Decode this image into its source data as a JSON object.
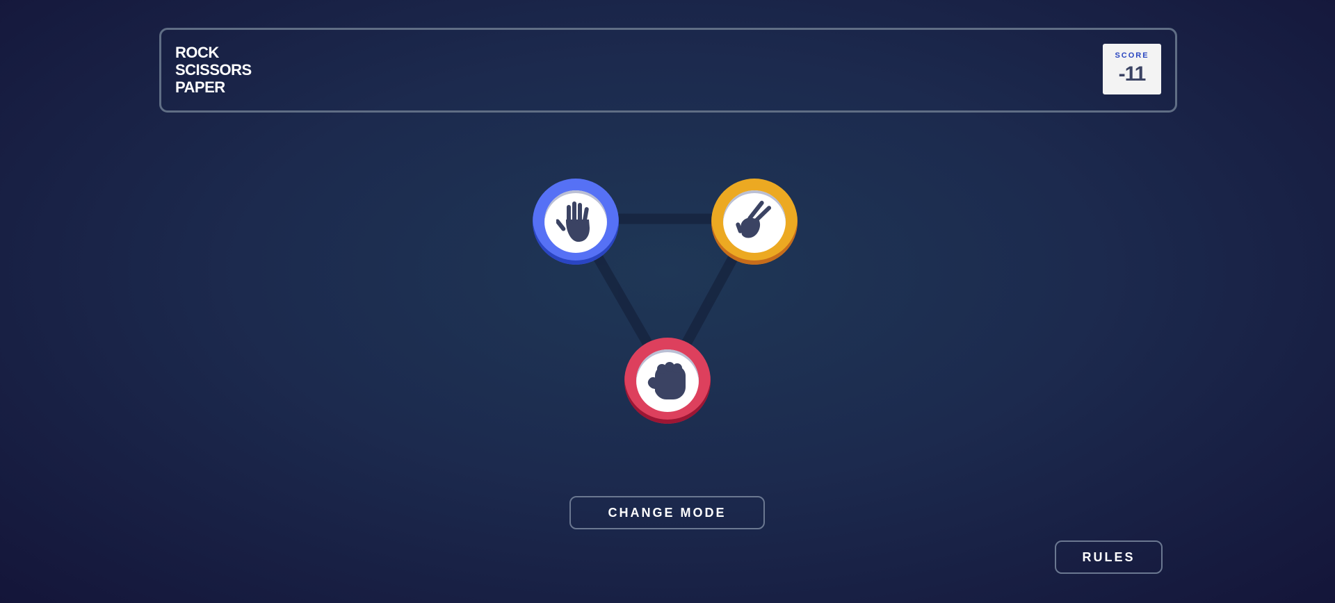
{
  "header": {
    "title_lines": [
      "ROCK",
      "SCISSORS",
      "PAPER"
    ],
    "score_label": "SCORE",
    "score_value": "-11"
  },
  "tokens": [
    {
      "name": "paper",
      "icon": "paper-hand-icon",
      "color": "#5671f5"
    },
    {
      "name": "scissors",
      "icon": "scissors-hand-icon",
      "color": "#eca922"
    },
    {
      "name": "rock",
      "icon": "rock-fist-icon",
      "color": "#dd405d"
    }
  ],
  "buttons": {
    "change_mode": "CHANGE MODE",
    "rules": "RULES"
  },
  "colors": {
    "background": "#1f3756",
    "header_border": "#606e85",
    "icon": "#3b4363"
  }
}
